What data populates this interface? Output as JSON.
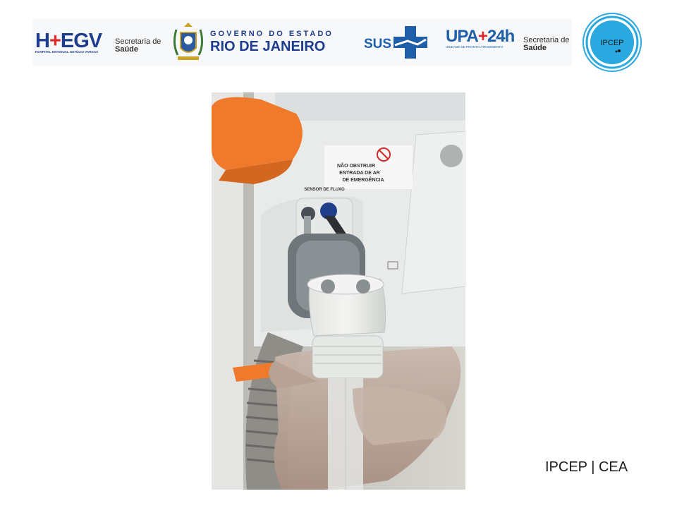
{
  "header": {
    "hegv": {
      "mark_pre": "H",
      "mark_plus": "+",
      "mark_post": "EGV",
      "subtitle": "HOSPITAL ESTADUAL GETÚLIO VARGAS"
    },
    "secretaria_left": {
      "line1": "Secretaria de",
      "line2": "Saúde"
    },
    "governo": {
      "line1": "GOVERNO DO ESTADO",
      "line2": "RIO DE JANEIRO"
    },
    "sus": {
      "label": "SUS"
    },
    "upa": {
      "mark_pre": "UPA",
      "mark_post": "24h",
      "subtitle": "UNIDADE DE PRONTO ATENDIMENTO"
    },
    "secretaria_right": {
      "line1": "Secretaria de",
      "line2": "Saúde"
    },
    "ipcep": {
      "label": "IPCEP"
    }
  },
  "photo": {
    "label_warning_1": "NÃO OBSTRUIR",
    "label_warning_2": "ENTRADA DE AR",
    "label_warning_3": "DE EMERGÊNCIA",
    "label_sensor": "SENSOR DE FLUXO"
  },
  "footer": {
    "text": "IPCEP | CEA"
  },
  "colors": {
    "brand_blue": "#1f3d8f",
    "sus_blue": "#1f5ea8",
    "accent_red": "#e02a2a",
    "device_orange": "#f07a2c"
  }
}
